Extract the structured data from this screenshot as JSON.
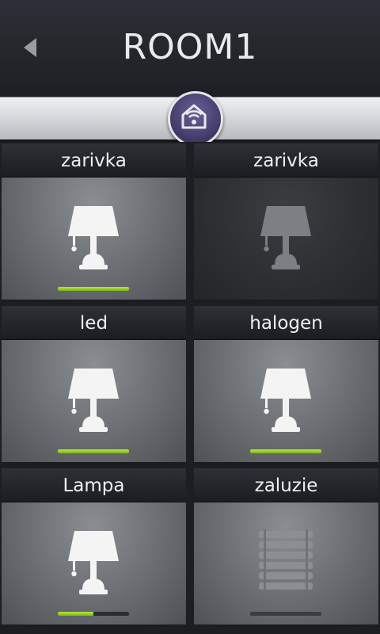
{
  "header": {
    "title": "ROOM1"
  },
  "colors": {
    "accent_on": "#a6d62f",
    "home_button": "#4a4172"
  },
  "tiles": [
    {
      "label": "zarivka",
      "icon": "table-lamp-icon",
      "state": "on",
      "level": 1.0
    },
    {
      "label": "zarivka",
      "icon": "table-lamp-icon",
      "state": "off",
      "level": 0.0
    },
    {
      "label": "led",
      "icon": "table-lamp-icon",
      "state": "on",
      "level": 1.0
    },
    {
      "label": "halogen",
      "icon": "table-lamp-icon",
      "state": "on",
      "level": 1.0
    },
    {
      "label": "Lampa",
      "icon": "table-lamp-icon",
      "state": "on",
      "level": 0.5
    },
    {
      "label": "zaluzie",
      "icon": "blinds-icon",
      "state": "off-bar",
      "level": 0.0
    }
  ]
}
